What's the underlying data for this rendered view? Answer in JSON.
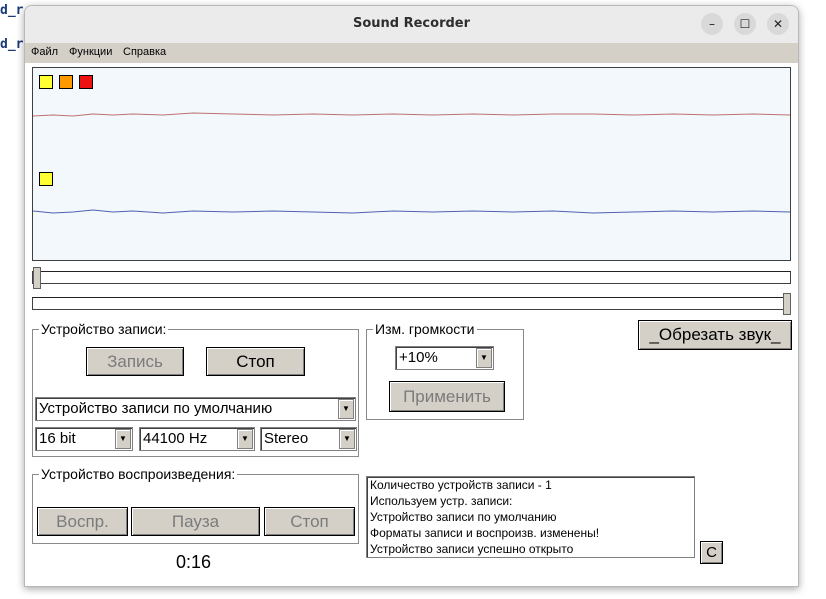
{
  "background_text": [
    "d_r",
    "d_r"
  ],
  "window": {
    "title": "Sound Recorder",
    "controls": {
      "minimize": "–",
      "maximize": "☐",
      "close": "✕"
    }
  },
  "menu": [
    "Файл",
    "Функции",
    "Справка"
  ],
  "waveform": {
    "channel1_color": "#c07070",
    "channel2_color": "#5060b0",
    "markers_channel1": [
      "#ffff33",
      "#ff9900",
      "#ee1111"
    ],
    "markers_channel2": [
      "#ffff33"
    ]
  },
  "record_group": {
    "label": "Устройство записи:",
    "record_button": "Запись",
    "stop_button": "Стоп",
    "device_select": "Устройство записи по умолчанию",
    "bits_select": "16 bit",
    "rate_select": "44100 Hz",
    "channels_select": "Stereo"
  },
  "volume_group": {
    "label": "Изм. громкости",
    "volume_select": "+10%",
    "apply_button": "Применить"
  },
  "trim_button": "_Обрезать звук_",
  "playback_group": {
    "label": "Устройство воспроизведения:",
    "play_button": "Воспр.",
    "pause_button": "Пауза",
    "stop_button": "Стоп"
  },
  "log_lines": [
    "Количество устройств записи - 1",
    "Используем устр. записи:",
    "Устройство записи по умолчанию",
    "Форматы записи и воспроизв. изменены!",
    "Устройство записи успешно открыто"
  ],
  "clear_button": "C",
  "timer": "0:16"
}
